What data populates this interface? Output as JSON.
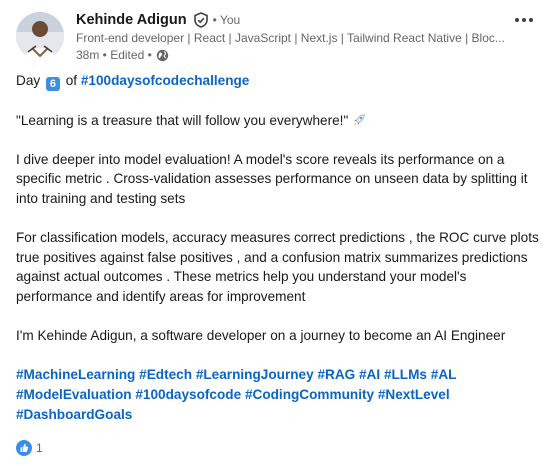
{
  "author": {
    "name": "Kehinde Adigun",
    "you_label": "• You",
    "headline": "Front-end developer | React | JavaScript | Next.js | Tailwind React Native | Bloc...",
    "timestamp": "38m • Edited •",
    "avatar": "avatar-photo",
    "verified_icon": "verified-shield-icon",
    "visibility_icon": "globe-icon"
  },
  "menu": {
    "icon": "more-options-icon"
  },
  "post": {
    "line1_before": "Day",
    "day_number": "6",
    "line1_of": "of",
    "line1_hashtag": "#100daysofcodechallenge",
    "quote": "\"Learning is a treasure that will follow you everywhere!\"",
    "para1": "I dive deeper into model evaluation! A model's score reveals its performance on a specific metric . Cross-validation assesses performance on unseen data by splitting it into training and testing sets",
    "para2": "For classification models, accuracy measures correct predictions , the ROC curve plots true positives against false positives , and a confusion matrix summarizes predictions against actual outcomes . These metrics help you understand your model's performance and identify areas for improvement",
    "para3": "I'm Kehinde Adigun, a software developer on a journey to become an AI Engineer",
    "hashtags": [
      "#MachineLearning",
      "#Edtech",
      "#LearningJourney",
      "#RAG",
      "#AI",
      "#LLMs",
      "#AL",
      "#ModelEvaluation",
      "#100daysofcode",
      "#CodingCommunity",
      "#NextLevel",
      "#DashboardGoals"
    ]
  },
  "reactions": {
    "count": "1",
    "icon": "like-icon"
  },
  "colors": {
    "link": "#0a66c2",
    "text": "#191919",
    "muted": "#666666",
    "like_blue": "#378fe9"
  }
}
